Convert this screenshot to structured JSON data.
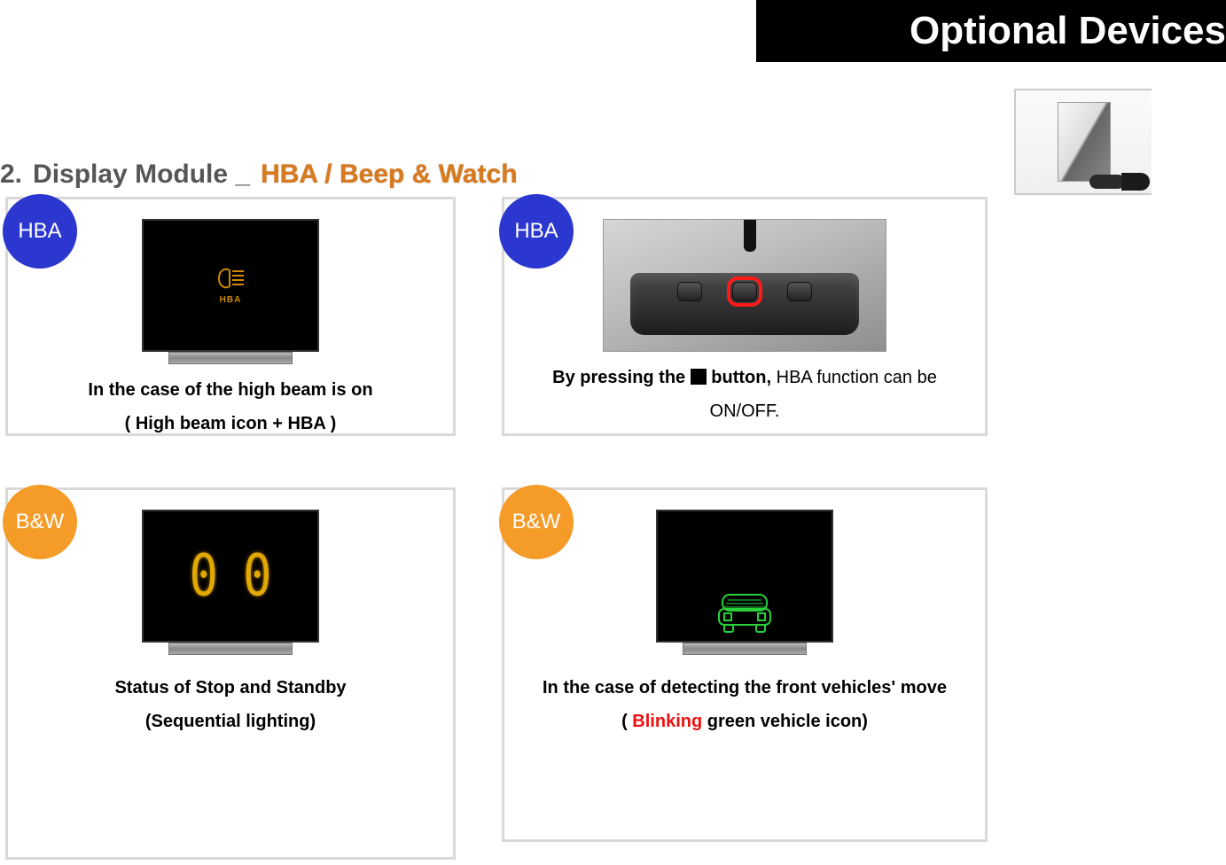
{
  "banner_title": "Optional Devices",
  "heading": {
    "number": "2.",
    "title": "Display Module _",
    "subtitle": "HBA / Beep & Watch"
  },
  "badges": {
    "hba": "HBA",
    "bw": "B&W"
  },
  "panel_tl": {
    "line1": "In the case of the high beam is on",
    "line2": "( High beam icon + HBA )",
    "hba_label": "HBA"
  },
  "panel_tr": {
    "prefix": "By pressing the ",
    "bold_after_square": " button,",
    "rest": " HBA function can be ON/OFF."
  },
  "panel_bl": {
    "line1": "Status of Stop and Standby",
    "line2": "(Sequential lighting)",
    "display_digits": [
      "0",
      "0"
    ]
  },
  "panel_br": {
    "line1": "In the case of detecting the front vehicles' move",
    "paren_open": "( ",
    "blinking_word": "Blinking",
    "paren_rest": " green vehicle icon)"
  }
}
